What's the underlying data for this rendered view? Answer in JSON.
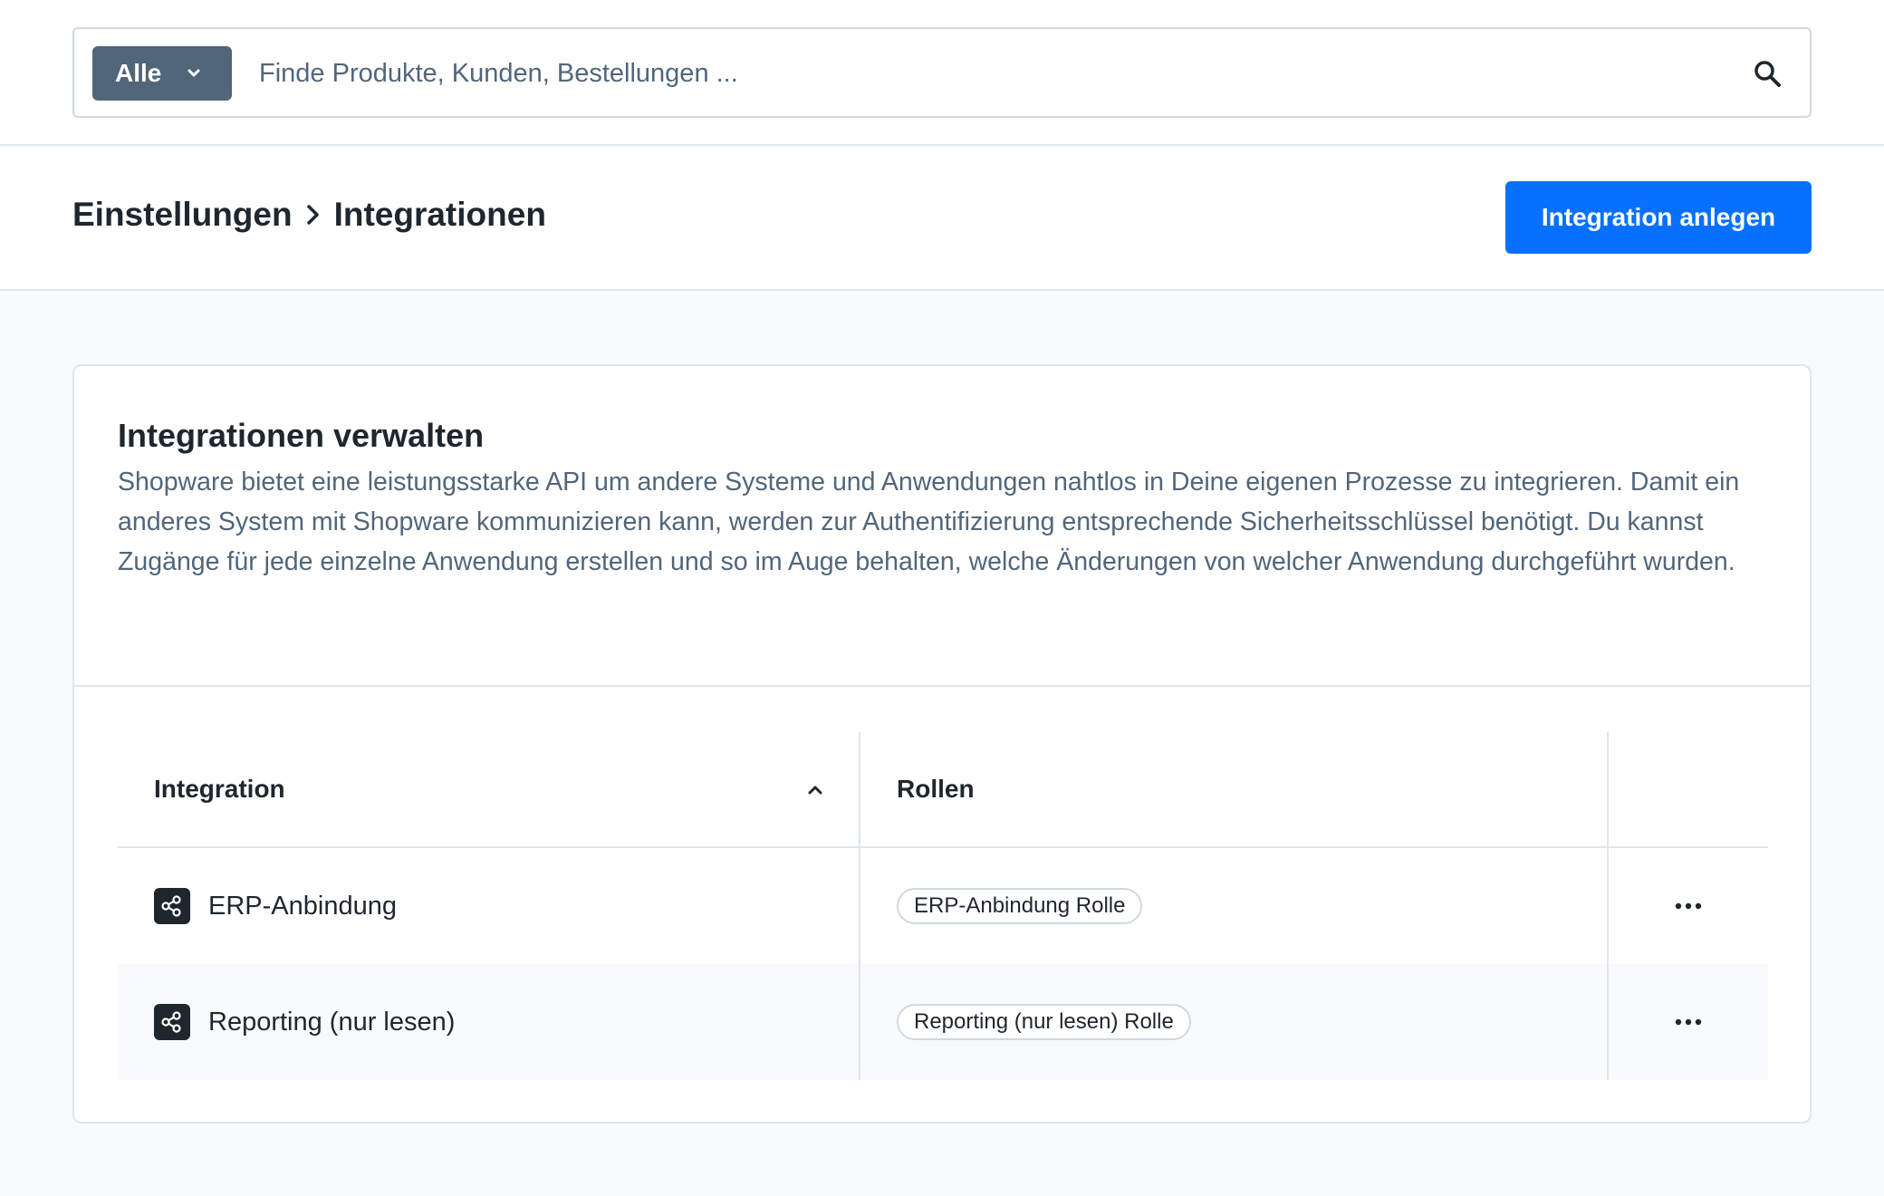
{
  "search": {
    "scope_label": "Alle",
    "placeholder": "Finde Produkte, Kunden, Bestellungen ..."
  },
  "header": {
    "breadcrumb": [
      "Einstellungen",
      "Integrationen"
    ],
    "create_button": "Integration anlegen"
  },
  "card": {
    "title": "Integrationen verwalten",
    "description": "Shopware bietet eine leistungsstarke API um andere Systeme und Anwendungen nahtlos in Deine eigenen Prozesse zu integrieren. Damit ein anderes System mit Shopware kommunizieren kann, werden zur Authentifizierung entsprechende Sicherheitsschlüssel benötigt. Du kannst Zugänge für jede einzelne Anwendung erstellen und so im Auge behalten, welche Änderungen von welcher Anwendung durchgeführt wurden."
  },
  "table": {
    "columns": [
      "Integration",
      "Rollen"
    ],
    "sort": "ascending",
    "rows": [
      {
        "name": "ERP-Anbindung",
        "role": "ERP-Anbindung Rolle"
      },
      {
        "name": "Reporting (nur lesen)",
        "role": "Reporting (nur lesen) Rolle"
      }
    ]
  },
  "icons": {
    "scope_toggle": "chevron-down-icon",
    "search": "search-icon",
    "breadcrumb_separator": "chevron-right-icon",
    "sort": "chevron-up-icon",
    "integration": "share-icon",
    "row_actions": "more-horizontal-icon"
  },
  "colors": {
    "primary": "#0870ff",
    "scope_badge": "#52667a",
    "text": "#1f262e",
    "muted_text": "#52667a",
    "border": "#e0e6ed",
    "background": "#f9fafc"
  }
}
